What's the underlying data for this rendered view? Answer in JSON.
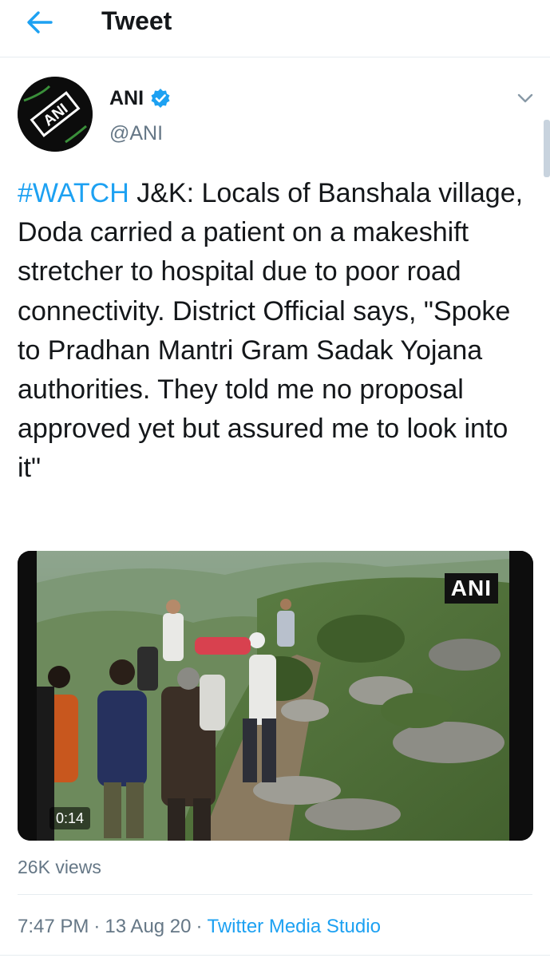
{
  "header": {
    "title": "Tweet",
    "back_icon": "arrow-left-icon"
  },
  "author": {
    "name": "ANI",
    "handle": "@ANI",
    "verified": true,
    "avatar_text": "ANI"
  },
  "tweet": {
    "hashtag": "#WATCH",
    "text": " J&K: Locals of Banshala village, Doda carried a patient on a makeshift stretcher to hospital due to poor road connectivity. District Official says, \"Spoke to Pradhan Mantri Gram Sadak Yojana authorities. They told me no proposal approved yet but assured me to look into it\""
  },
  "media": {
    "watermark": "ANI",
    "duration": "0:14"
  },
  "stats": {
    "views": "26K views"
  },
  "meta": {
    "time": "7:47 PM",
    "date": "13 Aug 20",
    "source": "Twitter Media Studio",
    "separator": "·"
  },
  "colors": {
    "accent": "#1da1f2",
    "secondary_text": "#657786",
    "divider": "#e6ecf0"
  }
}
